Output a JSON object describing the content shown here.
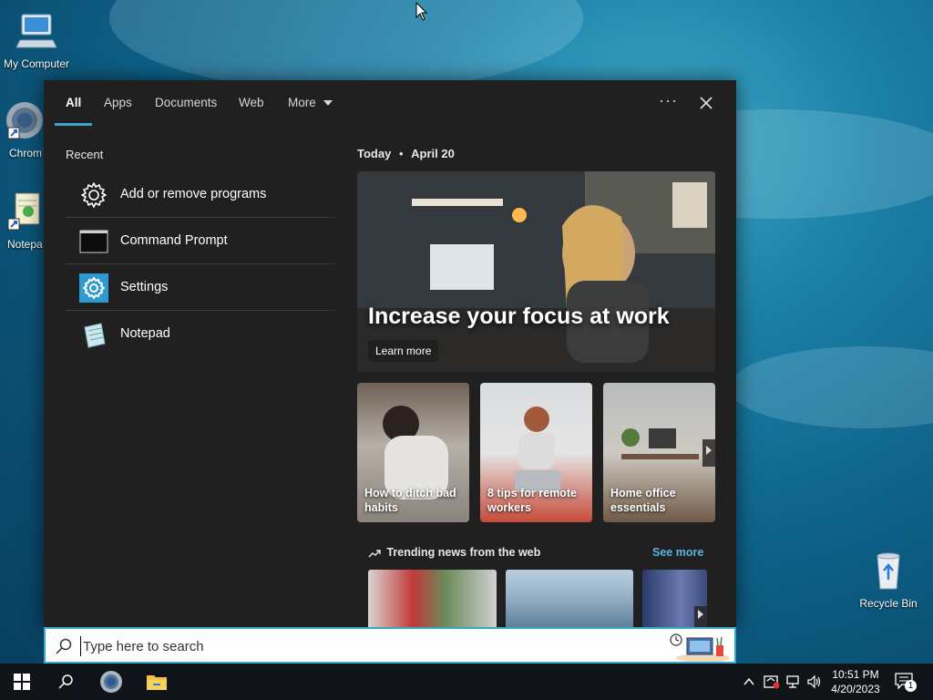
{
  "desktop": {
    "icons": [
      {
        "label": "My Computer"
      },
      {
        "label": "Chrom"
      },
      {
        "label": "Notepa"
      },
      {
        "label": "Recycle Bin"
      }
    ]
  },
  "search_panel": {
    "tabs": [
      {
        "label": "All",
        "active": true
      },
      {
        "label": "Apps"
      },
      {
        "label": "Documents"
      },
      {
        "label": "Web"
      },
      {
        "label": "More"
      }
    ],
    "more_options_label": "···",
    "recent": {
      "title": "Recent",
      "items": [
        {
          "label": "Add or remove programs",
          "icon": "gear-outline-icon"
        },
        {
          "label": "Command Prompt",
          "icon": "command-prompt-icon"
        },
        {
          "label": "Settings",
          "icon": "settings-gear-icon"
        },
        {
          "label": "Notepad",
          "icon": "notepad-icon"
        }
      ]
    },
    "today": {
      "prefix": "Today",
      "separator": "•",
      "date": "April 20"
    },
    "hero": {
      "title": "Increase your focus at work",
      "button": "Learn more"
    },
    "cards": [
      {
        "title": "How to ditch bad habits"
      },
      {
        "title": "8 tips for remote workers"
      },
      {
        "title": "Home office essentials"
      }
    ],
    "trending": {
      "title": "Trending news from the web",
      "see_more": "See more"
    }
  },
  "search_bar": {
    "placeholder": "Type here to search"
  },
  "taskbar": {
    "clock_time": "10:51 PM",
    "clock_date": "4/20/2023",
    "notification_count": "1"
  },
  "colors": {
    "accent": "#3ba5cf",
    "panel_bg": "#202020",
    "link": "#58b4e6",
    "taskbar": "#101418"
  }
}
